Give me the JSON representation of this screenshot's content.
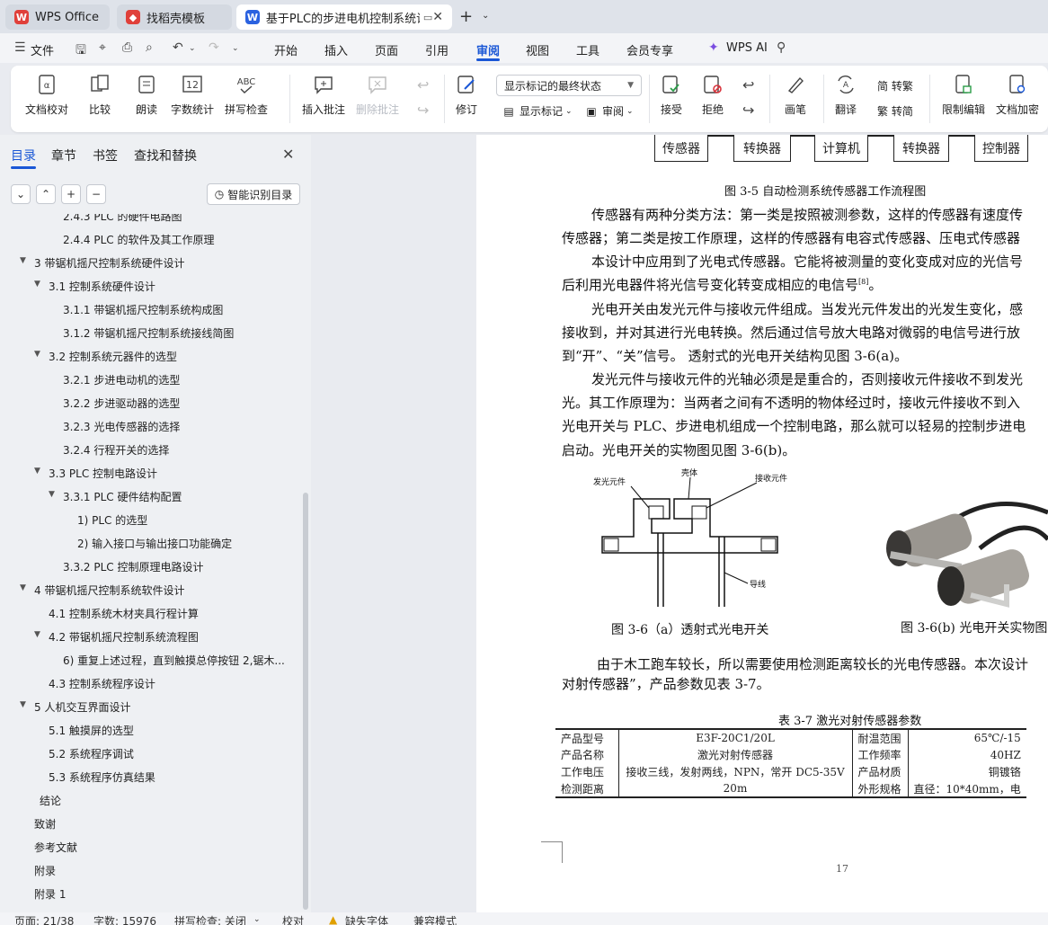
{
  "tabs": {
    "wps": "WPS Office",
    "template": "找稻壳模板",
    "doc": "基于PLC的步进电机控制系统设计"
  },
  "menu": {
    "file": "文件",
    "items": [
      "开始",
      "插入",
      "页面",
      "引用",
      "审阅",
      "视图",
      "工具",
      "会员专享"
    ],
    "active": "审阅",
    "wps_ai": "WPS AI"
  },
  "ribbon": {
    "doc_check": "文档校对",
    "compare": "比较",
    "read_aloud": "朗读",
    "word_count": "字数统计",
    "spell_check": "拼写检查",
    "insert_comment": "插入批注",
    "delete_comment": "删除批注",
    "revise": "修订",
    "show_mode": "显示标记的最终状态",
    "show_marks": "显示标记",
    "review": "审阅",
    "accept": "接受",
    "reject": "拒绝",
    "pen": "画笔",
    "translate": "翻译",
    "to_trad": "简 转繁",
    "to_simp": "繁 转简",
    "restrict_edit": "限制编辑",
    "doc_encrypt": "文档加密",
    "word_count_icon_text": "12",
    "spell_icon_text": "ABC"
  },
  "left_panel": {
    "tabs": [
      "目录",
      "章节",
      "书签",
      "查找和替换"
    ],
    "smart_toc": "智能识别目录",
    "toc": [
      {
        "label": "2.4.3 PLC 的硬件电路图",
        "level": 3
      },
      {
        "label": "2.4.4 PLC 的软件及其工作原理",
        "level": 3
      },
      {
        "label": "3 带锯机摇尺控制系统硬件设计",
        "level": 1,
        "expanded": true
      },
      {
        "label": "3.1 控制系统硬件设计",
        "level": 2,
        "expanded": true
      },
      {
        "label": "3.1.1 带锯机摇尺控制系统构成图",
        "level": 3
      },
      {
        "label": "3.1.2 带锯机摇尺控制系统接线简图",
        "level": 3
      },
      {
        "label": "3.2 控制系统元器件的选型",
        "level": 2,
        "expanded": true
      },
      {
        "label": "3.2.1 步进电动机的选型",
        "level": 3
      },
      {
        "label": "3.2.2 步进驱动器的选型",
        "level": 3
      },
      {
        "label": "3.2.3 光电传感器的选择",
        "level": 3
      },
      {
        "label": "3.2.4 行程开关的选择",
        "level": 3
      },
      {
        "label": "3.3 PLC 控制电路设计",
        "level": 2,
        "expanded": true
      },
      {
        "label": "3.3.1 PLC 硬件结构配置",
        "level": 3,
        "expanded": true
      },
      {
        "label": "1) PLC 的选型",
        "level": 4
      },
      {
        "label": "2) 输入接口与输出接口功能确定",
        "level": 4
      },
      {
        "label": "3.3.2 PLC 控制原理电路设计",
        "level": 3
      },
      {
        "label": "4 带锯机摇尺控制系统软件设计",
        "level": 1,
        "expanded": true
      },
      {
        "label": "4.1 控制系统木材夹具行程计算",
        "level": 2
      },
      {
        "label": "4.2 带锯机摇尺控制系统流程图",
        "level": 2,
        "expanded": true
      },
      {
        "label": "6) 重复上述过程，直到触摸总停按钮 2,锯木...",
        "level": 3
      },
      {
        "label": "4.3 控制系统程序设计",
        "level": 2
      },
      {
        "label": "5 人机交互界面设计",
        "level": 1,
        "expanded": true
      },
      {
        "label": "5.1 触摸屏的选型",
        "level": 2
      },
      {
        "label": "5.2 系统程序调试",
        "level": 2
      },
      {
        "label": "5.3 系统程序仿真结果",
        "level": 2
      },
      {
        "label": "结论",
        "level": 1.5
      },
      {
        "label": "致谢",
        "level": 1
      },
      {
        "label": "参考文献",
        "level": 1
      },
      {
        "label": "附录",
        "level": 1
      },
      {
        "label": "附录 1",
        "level": 1
      }
    ]
  },
  "document": {
    "flow_boxes": [
      "传感器",
      "转换器",
      "计算机",
      "转换器",
      "控制器"
    ],
    "fig35_caption": "图 3-5  自动检测系统传感器工作流程图",
    "lines": [
      "传感器有两种分类方法：第一类是按照被测参数，这样的传感器有速度传",
      "传感器；第二类是按工作原理，这样的传感器有电容式传感器、压电式传感器",
      "本设计中应用到了光电式传感器。它能将被测量的变化变成对应的光信号",
      "后利用光电器件将光信号变化转变成相应的电信号",
      "光电开关由发光元件与接收元件组成。当发光元件发出的光发生变化，感",
      "接收到，并对其进行光电转换。然后通过信号放大电路对微弱的电信号进行放",
      "到“开”、“关”信号。 透射式的光电开关结构见图 3-6(a)。",
      "发光元件与接收元件的光轴必须是是重合的，否则接收元件接收不到发光",
      "光。其工作原理为：当两者之间有不透明的物体经过时，接收元件接收不到入",
      "光电开关与 PLC、步进电机组成一个控制电路，那么就可以轻易的控制步进电",
      "启动。光电开关的实物图见图 3-6(b)。",
      "由于木工跑车较长，所以需要使用检测距离较长的光电传感器。本次设计",
      "对射传感器”，产品参数见表 3-7。"
    ],
    "ref_mark": "[8]",
    "end_mark": "。",
    "fig36_labels": {
      "emitter": "发光元件",
      "housing": "壳体",
      "receiver": "接收元件",
      "wire": "导线"
    },
    "fig36a_caption": "图 3-6（a）透射式光电开关",
    "fig36b_caption": "图 3-6(b)   光电开关实物图",
    "table_title": "表 3-7  激光对射传感器参数",
    "table_rows": [
      [
        "产品型号",
        "E3F-20C1/20L",
        "耐温范围",
        "65℃/-15"
      ],
      [
        "产品名称",
        "激光对射传感器",
        "工作频率",
        "40HZ"
      ],
      [
        "工作电压",
        "接收三线，发射两线，NPN，常开 DC5-35V",
        "产品材质",
        "铜镀铬"
      ],
      [
        "检测距离",
        "20m",
        "外形规格",
        "直径：10*40mm，电"
      ]
    ],
    "page_number": "17"
  },
  "status": {
    "page": "页面: 21/38",
    "words": "字数: 15976",
    "spell": "拼写检查: 关闭",
    "proof": "校对",
    "missing_font": "缺失字体",
    "compat": "兼容模式"
  },
  "colors": {
    "accent": "#1a57d6",
    "wps_red": "#e0403a",
    "word_blue": "#2b62e0"
  }
}
